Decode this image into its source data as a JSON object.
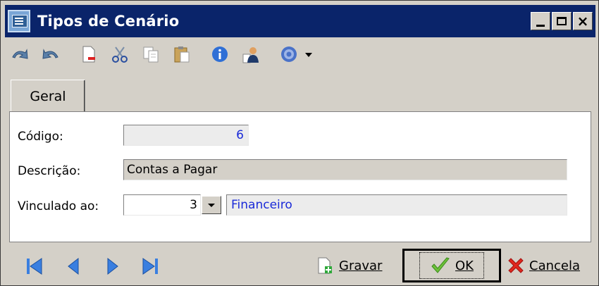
{
  "window": {
    "title": "Tipos de Cenário"
  },
  "toolbar": {
    "icons": [
      "undo-icon",
      "redo-icon",
      "new-doc-icon",
      "cut-icon",
      "copy-icon",
      "paste-icon",
      "info-icon",
      "user-doc-icon",
      "help-icon",
      "dropdown-arrow-icon"
    ]
  },
  "tabs": [
    {
      "label": "Geral"
    }
  ],
  "form": {
    "codigo": {
      "label": "Código:",
      "value": "6"
    },
    "descricao": {
      "label": "Descrição:",
      "value": "Contas a Pagar"
    },
    "vinculado": {
      "label": "Vinculado ao:",
      "number": "3",
      "name": "Financeiro"
    }
  },
  "bottom": {
    "gravar_label": "Gravar",
    "ok_label": "OK",
    "cancela_label": "Cancela"
  },
  "colors": {
    "titlebar": "#0a246a",
    "face": "#d4d0c8",
    "link_value": "#1a2ad8"
  }
}
